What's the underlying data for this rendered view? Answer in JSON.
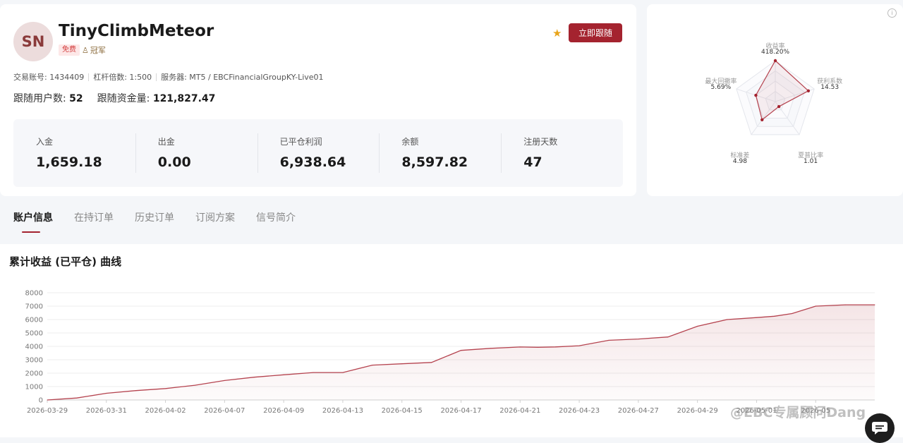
{
  "profile": {
    "avatar_initials": "SN",
    "name": "TinyClimbMeteor",
    "badge_free": "免费",
    "badge_rank": "冠军",
    "follow_button": "立即跟随",
    "meta": [
      "交易账号: 1434409",
      "杠杆倍数: 1:500",
      "服务器: MT5 / EBCFinancialGroupKY-Live01"
    ],
    "followers_label": "跟随用户数:",
    "followers_value": "52",
    "follow_funds_label": "跟随资金量:",
    "follow_funds_value": "121,827.47"
  },
  "stats": [
    {
      "label": "入金",
      "value": "1,659.18"
    },
    {
      "label": "出金",
      "value": "0.00"
    },
    {
      "label": "已平仓利润",
      "value": "6,938.64"
    },
    {
      "label": "余额",
      "value": "8,597.82"
    },
    {
      "label": "注册天数",
      "value": "47"
    }
  ],
  "radar": {
    "axes": [
      {
        "label": "收益率",
        "value": "418.20%"
      },
      {
        "label": "获利系数",
        "value": "14.53"
      },
      {
        "label": "夏普比率",
        "value": "1.01"
      },
      {
        "label": "标准差",
        "value": "4.98"
      },
      {
        "label": "最大回撤率",
        "value": "5.69%"
      }
    ],
    "levels": [
      1.0,
      0.85,
      0.15,
      0.55,
      0.5
    ]
  },
  "tabs": [
    "账户信息",
    "在持订单",
    "历史订单",
    "订阅方案",
    "信号简介"
  ],
  "chart": {
    "title": "累计收益 (已平仓) 曲线"
  },
  "chart_data": {
    "type": "area",
    "xlabel": "",
    "ylabel": "",
    "ylim": [
      0,
      8000
    ],
    "yticks": [
      0,
      1000,
      2000,
      3000,
      4000,
      5000,
      6000,
      7000,
      8000
    ],
    "xtick_labels": [
      "2026-03-29",
      "2026-03-31",
      "2026-04-02",
      "2026-04-07",
      "2026-04-09",
      "2026-04-13",
      "2026-04-15",
      "2026-04-17",
      "2026-04-21",
      "2026-04-23",
      "2026-04-27",
      "2026-04-29",
      "2026-05-01",
      "2026-05"
    ],
    "x": [
      0,
      0.5,
      1,
      1.5,
      2,
      2.5,
      3,
      3.5,
      4,
      4.5,
      5,
      5.5,
      6,
      6.5,
      7,
      7.5,
      8,
      8.3,
      8.6,
      9,
      9.5,
      10,
      10.5,
      11,
      11.5,
      12,
      12.3,
      12.6,
      13,
      13.5,
      14
    ],
    "y": [
      0,
      150,
      500,
      700,
      850,
      1100,
      1450,
      1700,
      1880,
      2050,
      2050,
      2600,
      2700,
      2800,
      3700,
      3850,
      3950,
      3930,
      3960,
      4050,
      4450,
      4550,
      4700,
      5500,
      6000,
      6150,
      6250,
      6450,
      7000,
      7100,
      7100
    ],
    "grid": true,
    "line_color": "#b5434f"
  },
  "watermark": "@EBC专属顾问Dang",
  "colors": {
    "accent": "#a4232f",
    "star": "#e8a41a"
  }
}
